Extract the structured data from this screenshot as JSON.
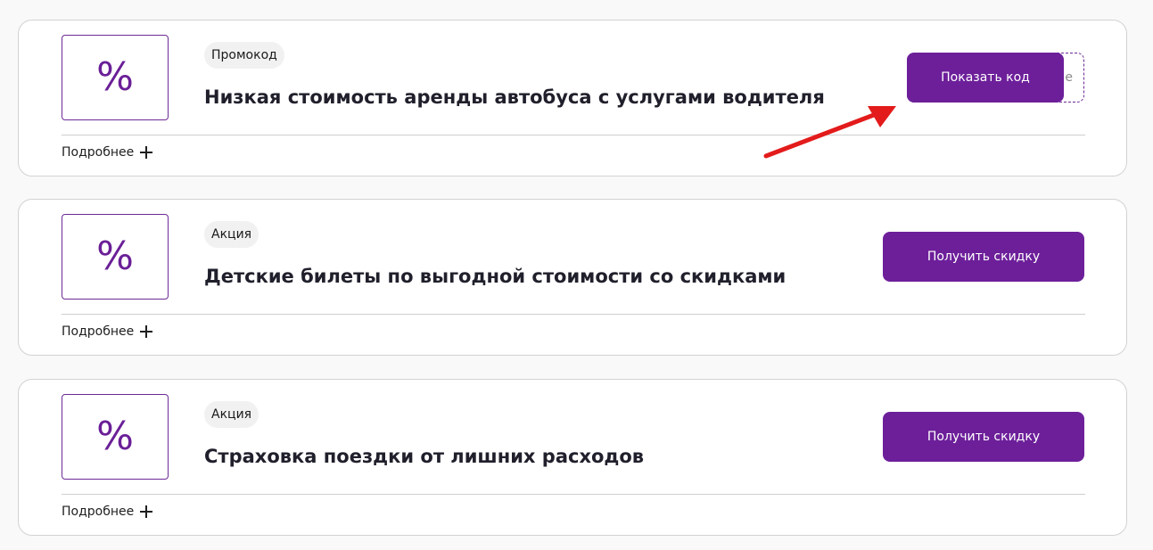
{
  "colors": {
    "brand": "#6d1f9a",
    "arrow": "#e31b1b"
  },
  "offers": [
    {
      "logo_symbol": "%",
      "badge": "Промокод",
      "title": "Низкая стоимость аренды автобуса с услугами водителя",
      "button_label": "Показать код",
      "code_peek": "е",
      "more_label": "Подробнее"
    },
    {
      "logo_symbol": "%",
      "badge": "Акция",
      "title": "Детские билеты по выгодной стоимости со скидками",
      "button_label": "Получить скидку",
      "more_label": "Подробнее"
    },
    {
      "logo_symbol": "%",
      "badge": "Акция",
      "title": "Страховка поездки от лишних расходов",
      "button_label": "Получить скидку",
      "more_label": "Подробнее"
    }
  ]
}
